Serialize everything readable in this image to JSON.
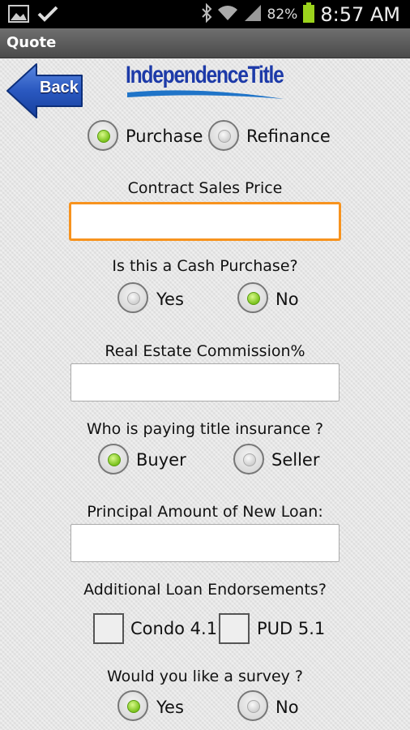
{
  "status_bar": {
    "battery_percent": "82%",
    "time": "8:57 AM",
    "icons": [
      "image-icon",
      "check-icon",
      "bluetooth-icon",
      "wifi-icon",
      "signal-icon",
      "battery-icon"
    ]
  },
  "title_bar": {
    "title": "Quote"
  },
  "header": {
    "back_label": "Back",
    "logo_text": "IndependenceTitle"
  },
  "transaction_type": {
    "options": [
      {
        "label": "Purchase",
        "selected": true
      },
      {
        "label": "Refinance",
        "selected": false
      }
    ]
  },
  "sales_price": {
    "label": "Contract Sales Price",
    "value": ""
  },
  "cash_purchase": {
    "question": "Is this a Cash Purchase?",
    "options": [
      {
        "label": "Yes",
        "selected": false
      },
      {
        "label": "No",
        "selected": true
      }
    ]
  },
  "commission": {
    "label": "Real Estate Commission%",
    "value": ""
  },
  "title_insurance": {
    "question": "Who is paying title insurance ?",
    "options": [
      {
        "label": "Buyer",
        "selected": true
      },
      {
        "label": "Seller",
        "selected": false
      }
    ]
  },
  "loan_amount": {
    "label": "Principal Amount of New Loan:",
    "value": ""
  },
  "endorsements": {
    "question": "Additional Loan Endorsements?",
    "options": [
      {
        "label": "Condo 4.1",
        "checked": false
      },
      {
        "label": "PUD 5.1",
        "checked": false
      }
    ]
  },
  "survey": {
    "question": "Would you like a survey ?",
    "options": [
      {
        "label": "Yes",
        "selected": true
      },
      {
        "label": "No",
        "selected": false
      }
    ]
  },
  "colors": {
    "accent_focus": "#f7931e",
    "radio_on": "#7ac21c",
    "back_button": "#1f4fb5",
    "logo_blue": "#1d3aa8"
  }
}
